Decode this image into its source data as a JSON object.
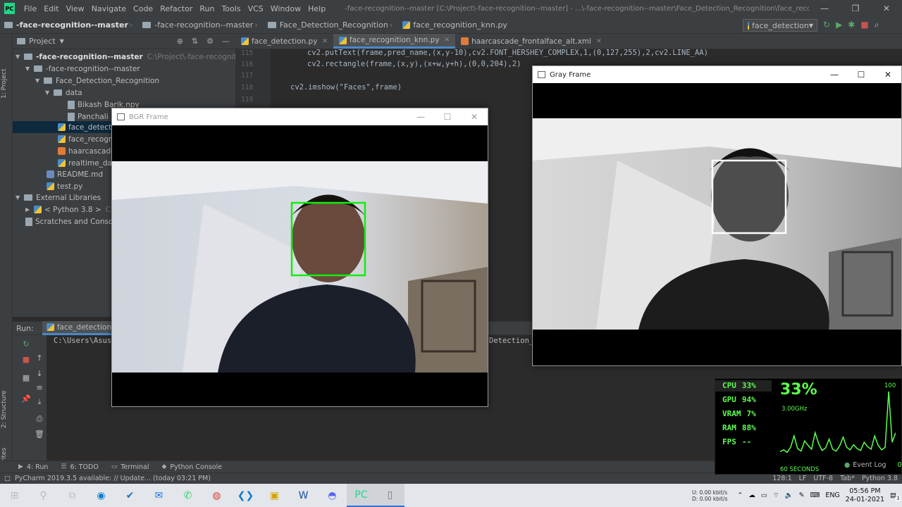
{
  "menubar": {
    "items": [
      "File",
      "Edit",
      "View",
      "Navigate",
      "Code",
      "Refactor",
      "Run",
      "Tools",
      "VCS",
      "Window",
      "Help"
    ],
    "title": "-face-recognition--master [C:\\Project\\-face-recognition--master] - ...\\-face-recognition--master\\Face_Detection_Recognition\\face_recognition_knn.py - PyCharm"
  },
  "navbar": {
    "crumbs": [
      "-face-recognition--master",
      "-face-recognition--master",
      "Face_Detection_Recognition",
      "face_recognition_knn.py"
    ],
    "run_config": "face_detection"
  },
  "project": {
    "header": "Project",
    "root": "-face-recognition--master",
    "root_path": "C:\\Project\\-face-recognition--master",
    "nodes": [
      "-face-recognition--master",
      "Face_Detection_Recognition",
      "data",
      "Bikash Barik.npy",
      "Panchali Ba",
      "face_detection",
      "face_recogniti",
      "haarcascade_f",
      "realtime_data",
      "README.md",
      "test.py",
      "External Libraries",
      "< Python 3.8 >",
      "C:\\Us",
      "Scratches and Consoles"
    ]
  },
  "left_strip": {
    "project_tab": "1: Project",
    "structure_tab": "2: Structure",
    "favorites_tab": "2: Favorites"
  },
  "tabs": [
    "face_detection.py",
    "face_recognition_knn.py",
    "haarcascade_frontalface_alt.xml"
  ],
  "editor": {
    "line_numbers": [
      "115",
      "116",
      "117",
      "118",
      "119"
    ],
    "lines": [
      "cv2.putText(frame,pred_name,(x,y-10),cv2.FONT_HERSHEY_COMPLEX,1,(0,127,255),2,cv2.LINE_AA)",
      "cv2.rectangle(frame,(x,y),(x+w,y+h),(0,0,204),2)",
      "",
      "cv2.imshow(\"Faces\",frame)",
      ""
    ]
  },
  "bgr_window": {
    "title": "BGR Frame"
  },
  "gray_window": {
    "title": "Gray Frame"
  },
  "run_panel": {
    "label": "Run:",
    "config": "face_detection",
    "output": "C:\\Users\\Asus\\",
    "output_right": "Detection_"
  },
  "bottom_tools": [
    "4: Run",
    "6: TODO",
    "Terminal",
    "Python Console"
  ],
  "event_log": {
    "label": "Event Log",
    "count": "0"
  },
  "status": {
    "message": "PyCharm 2019.3.5 available: // Update... (today 03:21 PM)",
    "position": "128:1",
    "line_sep": "LF",
    "encoding": "UTF-8",
    "indent": "Tab*",
    "interpreter": "Python 3.8"
  },
  "overlay": {
    "stats": [
      {
        "label": "CPU",
        "value": "33%"
      },
      {
        "label": "GPU",
        "value": "94%"
      },
      {
        "label": "VRAM",
        "value": "7%"
      },
      {
        "label": "RAM",
        "value": "88%"
      },
      {
        "label": "FPS",
        "value": "--"
      }
    ],
    "big": "33%",
    "freq": "3.00GHz",
    "max": "100",
    "window": "60 SECONDS",
    "cpu_history": [
      5,
      8,
      4,
      12,
      30,
      10,
      6,
      22,
      15,
      9,
      35,
      18,
      7,
      11,
      25,
      9,
      6,
      14,
      28,
      12,
      8,
      16,
      10,
      7,
      20,
      13,
      9,
      30,
      15,
      8,
      12,
      100,
      20,
      35
    ]
  },
  "taskbar": {
    "net_up": "0.00 kbit/s",
    "net_down": "0.00 kbit/s",
    "net_up_label": "U:",
    "net_down_label": "D:",
    "lang": "ENG",
    "time": "05:56 PM",
    "date": "24-01-2021",
    "notif": "3"
  },
  "colors": {
    "face_box_bgr": "#11ee11",
    "face_box_gray": "#ffffff",
    "overlay_green": "#5cff4d"
  }
}
